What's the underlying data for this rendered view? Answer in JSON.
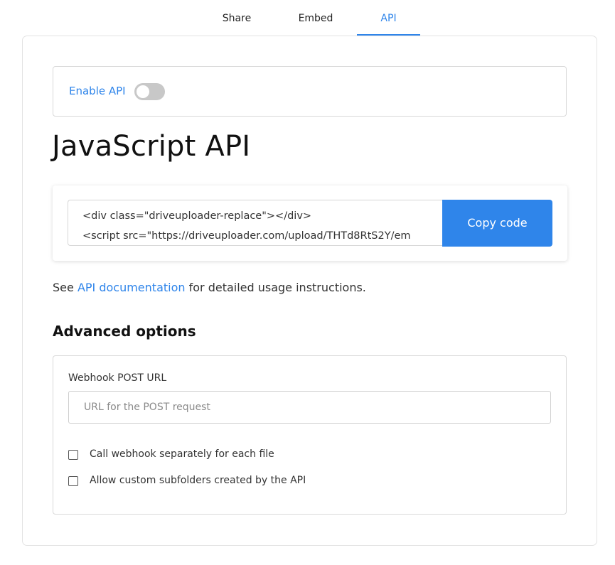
{
  "tabs": {
    "share": "Share",
    "embed": "Embed",
    "api": "API",
    "active": "API"
  },
  "api_toggle": {
    "label": "Enable API",
    "enabled": false
  },
  "heading": "JavaScript API",
  "code": {
    "line1": "<div class=\"driveuploader-replace\"></div>",
    "line2": "<script src=\"https://driveuploader.com/upload/THTd8RtS2Y/em",
    "copy_label": "Copy code"
  },
  "docs": {
    "prefix": "See ",
    "link": "API documentation",
    "suffix": " for detailed usage instructions."
  },
  "advanced": {
    "heading": "Advanced options",
    "webhook_label": "Webhook POST URL",
    "webhook_placeholder": "URL for the POST request",
    "webhook_value": "",
    "checkbox1_label": "Call webhook separately for each file",
    "checkbox1_checked": false,
    "checkbox2_label": "Allow custom subfolders created by the API",
    "checkbox2_checked": false
  },
  "colors": {
    "accent": "#2f85ea",
    "toggle_off": "#c8c8c8"
  }
}
